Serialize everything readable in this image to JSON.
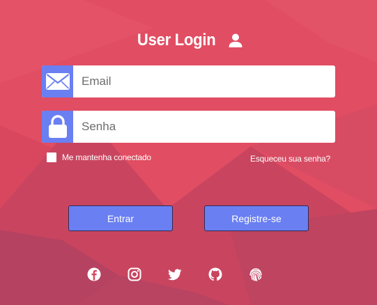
{
  "login": {
    "title": "User Login",
    "email_placeholder": "Email",
    "password_placeholder": "Senha",
    "remember_label": "Me mantenha conectado",
    "remember_checked": false,
    "forgot_label": "Esqueceu sua senha?",
    "login_button": "Entrar",
    "register_button": "Registre-se"
  },
  "icons": {
    "title": "user-icon",
    "email": "envelope-icon",
    "password": "lock-icon"
  },
  "socials": [
    "facebook-icon",
    "instagram-icon",
    "twitter-icon",
    "github-icon",
    "fingerprint-icon"
  ],
  "colors": {
    "background": "#e0495f",
    "background_dark": "#b84660",
    "accent": "#6a7ff2",
    "text": "#ffffff"
  }
}
